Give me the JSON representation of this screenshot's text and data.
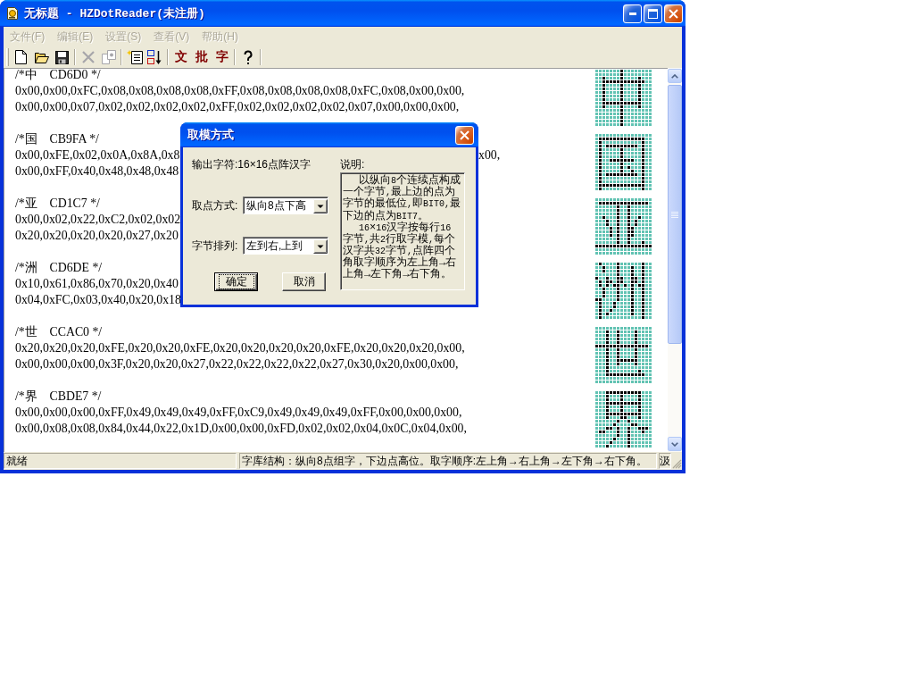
{
  "window": {
    "title": "无标题 - HZDotReader(未注册)"
  },
  "menu": [
    {
      "label": "文件(F)",
      "disabled": true
    },
    {
      "label": "编辑(E)",
      "disabled": true
    },
    {
      "label": "设置(S)",
      "disabled": true
    },
    {
      "label": "查看(V)",
      "disabled": true
    },
    {
      "label": "帮助(H)",
      "disabled": true
    }
  ],
  "toolbar": [
    [
      {
        "kind": "new-file",
        "disabled": false
      },
      {
        "kind": "open",
        "disabled": false
      },
      {
        "kind": "save",
        "disabled": false
      }
    ],
    [
      {
        "kind": "cross",
        "disabled": true
      },
      {
        "kind": "pages",
        "disabled": true
      }
    ],
    [
      {
        "kind": "notepad",
        "disabled": false
      },
      {
        "kind": "sort",
        "disabled": false
      }
    ],
    [
      {
        "kind": "text",
        "label": "文",
        "disabled": false
      },
      {
        "kind": "text",
        "label": "批",
        "disabled": false
      },
      {
        "kind": "text",
        "label": "字",
        "disabled": false
      }
    ],
    [
      {
        "kind": "help",
        "disabled": false
      }
    ]
  ],
  "entries": [
    {
      "header": "/*中    CD6D0 */",
      "lines": [
        {
          "text": "0x00,0x00,0xFC,0x08,0x08,0x08,0x08,0xFF,0x08,0x08,0x08,0x08,0xFC,0x08,0x00,0x00,"
        },
        {
          "text": "0x00,0x00,0x07,0x02,0x02,0x02,0x02,0xFF,0x02,0x02,0x02,0x02,0x07,0x00,0x00,0x00,"
        }
      ]
    },
    {
      "header": "/*国    CB9FA */",
      "lines": [
        {
          "text": "0x00,0xFE,0x02,0x0A,0x8A,0x8",
          "tail": "x00,"
        },
        {
          "text": "0x00,0xFF,0x40,0x48,0x48,0x48"
        }
      ]
    },
    {
      "header": "/*亚    CD1C7 */",
      "lines": [
        {
          "text": "0x00,0x02,0x22,0xC2,0x02,0x02"
        },
        {
          "text": "0x20,0x20,0x20,0x20,0x27,0x20"
        }
      ]
    },
    {
      "header": "/*洲    CD6DE */",
      "lines": [
        {
          "text": "0x10,0x61,0x86,0x70,0x20,0x40"
        },
        {
          "text": "0x04,0xFC,0x03,0x40,0x20,0x18"
        }
      ]
    },
    {
      "header": "/*世    CCAC0 */",
      "lines": [
        {
          "text": "0x20,0x20,0x20,0xFE,0x20,0x20,0xFE,0x20,0x20,0x20,0x20,0xFE,0x20,0x20,0x20,0x00,"
        },
        {
          "text": "0x00,0x00,0x00,0x3F,0x20,0x20,0x27,0x22,0x22,0x22,0x22,0x27,0x30,0x20,0x00,0x00,"
        }
      ]
    },
    {
      "header": "/*界    CBDE7 */",
      "lines": [
        {
          "text": "0x00,0x00,0x00,0xFF,0x49,0x49,0x49,0xFF,0xC9,0x49,0x49,0x49,0xFF,0x00,0x00,0x00,"
        },
        {
          "text": "0x00,0x08,0x08,0x84,0x44,0x22,0x1D,0x00,0x00,0xFD,0x02,0x02,0x04,0x0C,0x04,0x00,"
        }
      ]
    }
  ],
  "dialog": {
    "title": "取模方式",
    "output_label": "输出字符:16×16点阵汉字",
    "note_label": "说明:",
    "note": [
      "以纵向8个连续点构成一个字节,最上边的点为字节的最低位,即BIT0,最下边的点为BIT7。",
      "16×16汉字按每行16字节,共2行取字模,每个汉字共32字节,点阵四个角取字顺序为左上角→右上角→左下角→右下角。"
    ],
    "fields": [
      {
        "label": "取点方式:",
        "value": "纵向8点下高"
      },
      {
        "label": "字节排列:",
        "value": "左到右,上到"
      }
    ],
    "buttons": [
      {
        "label": "确定",
        "default": true
      },
      {
        "label": "取消",
        "default": false
      }
    ]
  },
  "status_bar": [
    "就绪",
    "字库结构：纵向8点组字，下边点高位。取字顺序:左上角→右上角→左下角→右下角。",
    "汲"
  ]
}
